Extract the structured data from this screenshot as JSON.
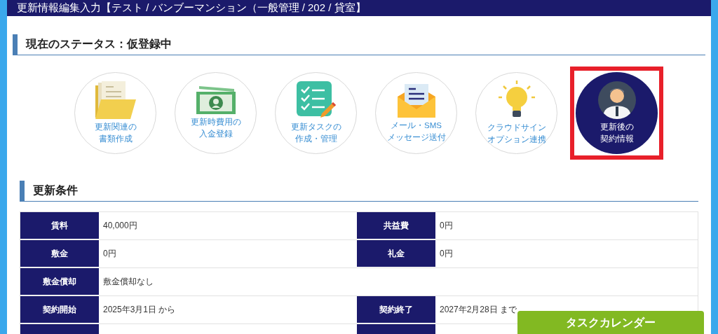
{
  "window": {
    "title": "更新情報編集入力【テスト / バンブーマンション（一般管理 / 202 / 貸室】"
  },
  "status_heading": "現在のステータス：仮登録中",
  "actions": [
    {
      "kind": "documents",
      "label": [
        "更新関連の",
        "書類作成"
      ],
      "selected": false
    },
    {
      "kind": "money",
      "label": [
        "更新時費用の",
        "入金登録"
      ],
      "selected": false
    },
    {
      "kind": "checklist",
      "label": [
        "更新タスクの",
        "作成・管理"
      ],
      "selected": false
    },
    {
      "kind": "mail",
      "label": [
        "メール・SMS",
        "メッセージ送付"
      ],
      "selected": false
    },
    {
      "kind": "bulb",
      "label": [
        "クラウドサイン",
        "オプション連携"
      ],
      "selected": false
    },
    {
      "kind": "person",
      "label": [
        "更新後の",
        "契約情報"
      ],
      "selected": true
    }
  ],
  "conditions": {
    "heading": "更新条件",
    "rows": [
      [
        {
          "label": "賃料",
          "value": "40,000円"
        },
        {
          "label": "共益費",
          "value": "0円"
        }
      ],
      [
        {
          "label": "敷金",
          "value": "0円"
        },
        {
          "label": "礼金",
          "value": "0円"
        }
      ],
      [
        {
          "label": "敷金償却",
          "value": "敷金償却なし"
        }
      ],
      [
        {
          "label": "契約開始",
          "value": "2025年3月1日 から"
        },
        {
          "label": "契約終了",
          "value": "2027年2月28日 まで"
        }
      ],
      []
    ]
  },
  "task_calendar_button": "タスクカレンダー"
}
